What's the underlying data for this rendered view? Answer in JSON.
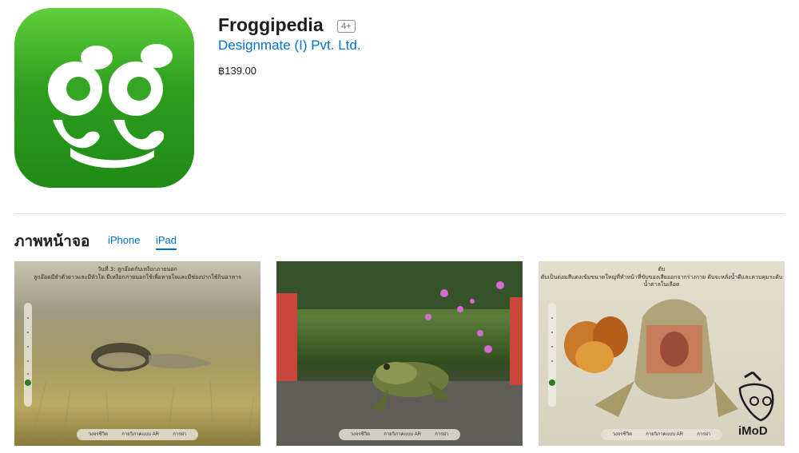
{
  "app": {
    "name": "Froggipedia",
    "age_rating": "4+",
    "developer": "Designmate (I) Pvt. Ltd.",
    "price": "฿139.00",
    "icon_name": "froggipedia-logo-icon",
    "icon_colors": [
      "#5fcf3a",
      "#1f8a16"
    ]
  },
  "screenshots_section": {
    "title": "ภาพหน้าจอ",
    "tabs": [
      {
        "label": "iPhone",
        "selected": false
      },
      {
        "label": "iPad",
        "selected": true
      }
    ],
    "items": [
      {
        "title": "วันที่ 3: ลูกอ๊อดกับเหงือกภายนอก",
        "subtitle": "ลูกอ๊อดมีลำตัวยาวและมีหัวโต มีเหงือกภายนอกใช้เพื่อหายใจและมีช่องปากใช้กินอาหาร",
        "toolbar": [
          "วงจรชีวิต",
          "กายวิภาคแบบ AR",
          "การผ่า"
        ]
      },
      {
        "title": "",
        "subtitle": "",
        "toolbar": [
          "วงจรชีวิต",
          "กายวิภาคแบบ AR",
          "การผ่า"
        ]
      },
      {
        "title": "ตับ",
        "subtitle": "ตับเป็นต่อมสีแดงเข้มขนาดใหญ่ที่ทำหน้าที่ขับของเสียออกจากร่างกาย ตับจะหลั่งน้ำดีและควบคุมระดับน้ำตาลในเลือด",
        "toolbar": [
          "วงจรชีวิต",
          "กายวิภาคแบบ AR",
          "การผ่า"
        ]
      }
    ]
  },
  "accent_color": "#0070c9",
  "watermark": {
    "text": "iMoD",
    "icon": "imod-mascot-icon"
  }
}
